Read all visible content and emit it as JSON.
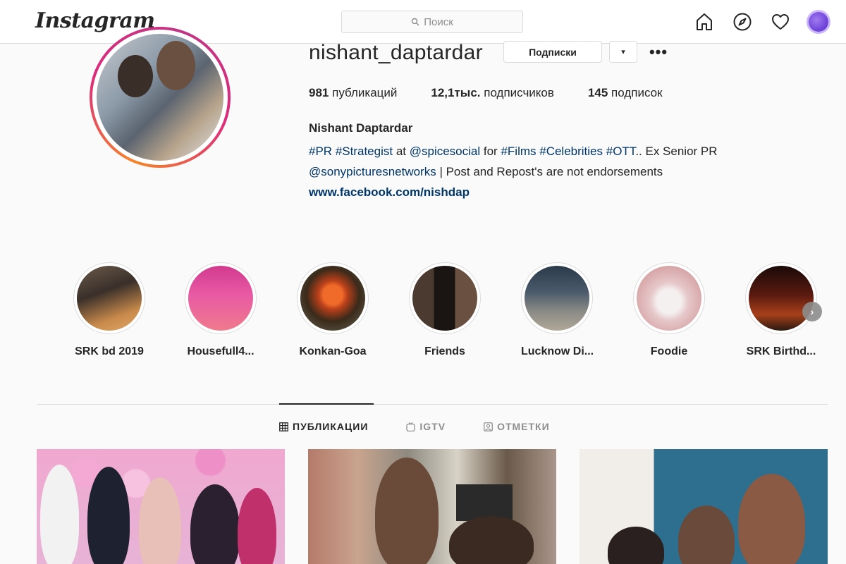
{
  "header": {
    "logo": "Instagram",
    "search_placeholder": "Поиск",
    "icons": [
      "home-icon",
      "explore-icon",
      "heart-icon",
      "profile-avatar"
    ]
  },
  "profile": {
    "username": "nishant_daptardar",
    "subscribed_button": "Подписки",
    "dropdown_glyph": "▾",
    "more_glyph": "•••",
    "stats": {
      "posts_count": "981",
      "posts_label": "публикаций",
      "followers_count": "12,1тыс.",
      "followers_label": "подписчиков",
      "following_count": "145",
      "following_label": "подписок"
    },
    "full_name": "Nishant Daptardar",
    "bio": {
      "tag_pr": "#PR",
      "tag_strategist": "#Strategist",
      "at_word": "at",
      "mention_spicesocial": "@spicesocial",
      "for_word": "for",
      "tag_films": "#Films",
      "tag_celebrities": "#Celebrities",
      "tag_ott": "#OTT",
      "suffix_1": ".. Ex Senior PR",
      "mention_sony": "@sonypicturesnetworks",
      "suffix_2": "| Post and Repost's are not endorsements",
      "website": "www.facebook.com/nishdap"
    }
  },
  "highlights": [
    {
      "label": "SRK bd 2019"
    },
    {
      "label": "Housefull4..."
    },
    {
      "label": "Konkan-Goa"
    },
    {
      "label": "Friends"
    },
    {
      "label": "Lucknow Di..."
    },
    {
      "label": "Foodie"
    },
    {
      "label": "SRK Birthd..."
    }
  ],
  "highlight_next_glyph": "›",
  "tabs": [
    {
      "label": "ПУБЛИКАЦИИ",
      "active": true
    },
    {
      "label": "IGTV",
      "active": false
    },
    {
      "label": "ОТМЕТКИ",
      "active": false
    }
  ],
  "colors": {
    "link": "#003569",
    "border": "#dbdbdb",
    "background": "#fafafa"
  }
}
